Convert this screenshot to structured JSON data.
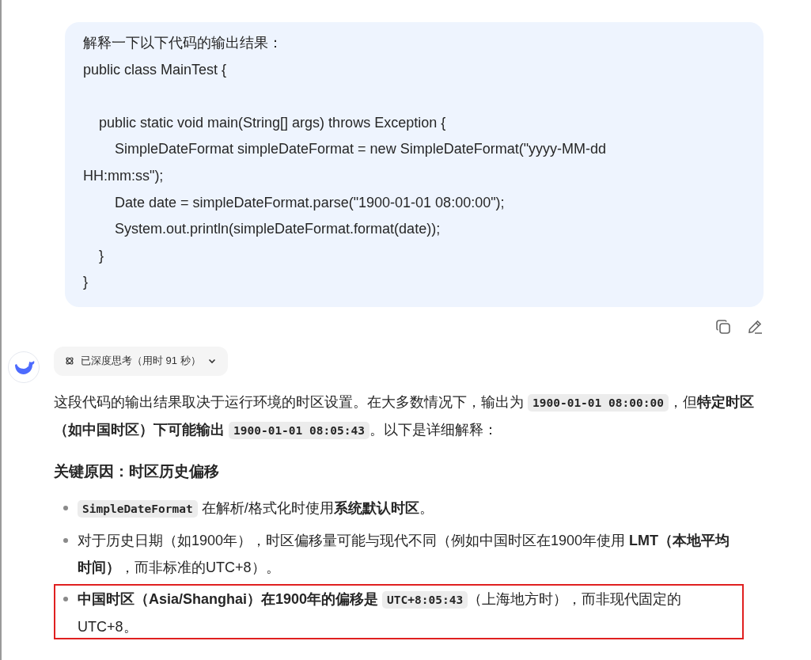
{
  "user_message": {
    "lines": [
      {
        "text": "解释一下以下代码的输出结果：",
        "blank_before": false
      },
      {
        "text": "public class MainTest {",
        "blank_before": false
      },
      {
        "text": "    public static void main(String[] args) throws Exception {",
        "blank_before": true
      },
      {
        "text": "        SimpleDateFormat simpleDateFormat = new SimpleDateFormat(\"yyyy-MM-dd",
        "blank_before": false
      },
      {
        "text": "HH:mm:ss\");",
        "blank_before": false
      },
      {
        "text": "        Date date = simpleDateFormat.parse(\"1900-01-01 08:00:00\");",
        "blank_before": false
      },
      {
        "text": "        System.out.println(simpleDateFormat.format(date));",
        "blank_before": false
      },
      {
        "text": "    }",
        "blank_before": false
      },
      {
        "text": "}",
        "blank_before": false
      }
    ]
  },
  "message_actions": [
    {
      "kind": "copy"
    },
    {
      "kind": "edit"
    }
  ],
  "thinking": {
    "label": "已深度思考（用时 91 秒）",
    "expanded": false
  },
  "answer": {
    "paragraph": [
      {
        "kind": "text",
        "text": "这段代码的输出结果取决于运行环境的时区设置。在大多数情况下，输出为 "
      },
      {
        "kind": "code",
        "text": "1900-01-01 08:00:00"
      },
      {
        "kind": "text",
        "text": "，但"
      },
      {
        "kind": "bold",
        "text": "特定时区（如中国时区）下可能输出 "
      },
      {
        "kind": "code",
        "text": "1900-01-01 08:05:43"
      },
      {
        "kind": "text",
        "text": "。以下是详细解释："
      }
    ],
    "heading": "关键原因：时区历史偏移",
    "bullets": [
      {
        "highlighted": false,
        "segments": [
          {
            "kind": "code",
            "text": "SimpleDateFormat"
          },
          {
            "kind": "text",
            "text": " 在解析/格式化时使用"
          },
          {
            "kind": "bold",
            "text": "系统默认时区"
          },
          {
            "kind": "text",
            "text": "。"
          }
        ]
      },
      {
        "highlighted": false,
        "segments": [
          {
            "kind": "text",
            "text": "对于历史日期（如1900年），时区偏移量可能与现代不同（例如中国时区在1900年使用 "
          },
          {
            "kind": "bold",
            "text": "LMT（本地平均时间）"
          },
          {
            "kind": "text",
            "text": "，而非标准的UTC+8）。"
          }
        ]
      },
      {
        "highlighted": true,
        "segments": [
          {
            "kind": "bold",
            "text": "中国时区（Asia/Shanghai）在1900年的偏移是 "
          },
          {
            "kind": "code",
            "text": "UTC+8:05:43"
          },
          {
            "kind": "text",
            "text": "（上海地方时），而非现代固定的UTC+8。"
          }
        ]
      }
    ]
  }
}
